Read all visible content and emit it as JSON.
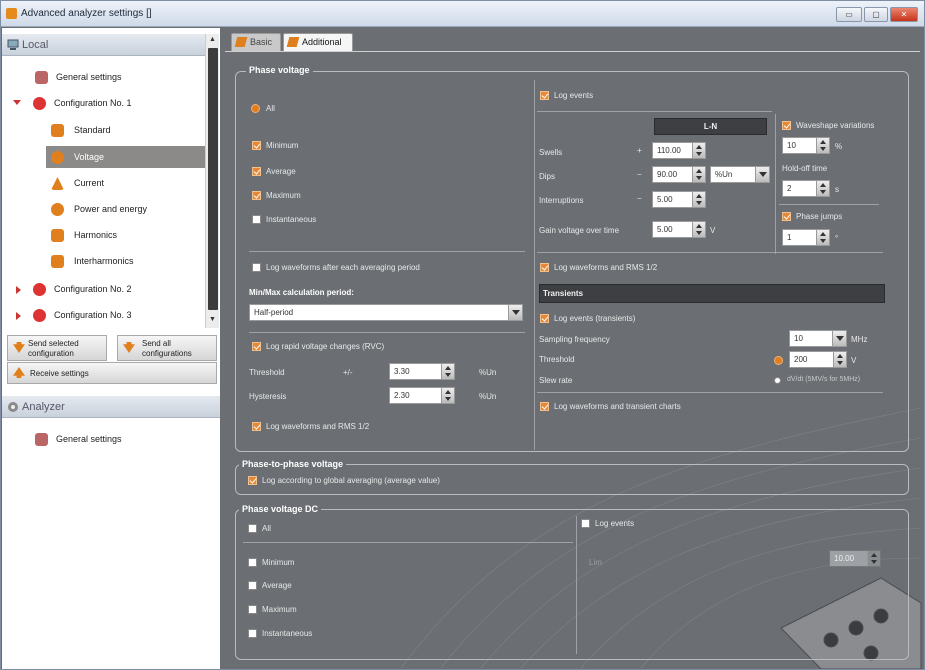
{
  "window": {
    "title": "Advanced analyzer settings []",
    "min": "▭",
    "max": "▢",
    "close": "✕"
  },
  "sidebar": {
    "local_header": "Local",
    "tree": [
      {
        "label": "General settings"
      },
      {
        "label": "Configuration No. 1"
      },
      {
        "label": "Standard"
      },
      {
        "label": "Voltage"
      },
      {
        "label": "Current"
      },
      {
        "label": "Power and energy"
      },
      {
        "label": "Harmonics"
      },
      {
        "label": "Interharmonics"
      },
      {
        "label": "Configuration No. 2"
      },
      {
        "label": "Configuration No. 3"
      }
    ],
    "send_selected_l1": "Send selected",
    "send_selected_l2": "configuration",
    "send_all_l1": "Send all",
    "send_all_l2": "configurations",
    "receive": "Receive settings",
    "analyzer_header": "Analyzer",
    "analyzer_general": "General settings"
  },
  "tabs": {
    "basic": "Basic",
    "additional": "Additional"
  },
  "phase_voltage": {
    "title": "Phase voltage",
    "all": "All",
    "minimum": "Minimum",
    "average": "Average",
    "maximum": "Maximum",
    "instantaneous": "Instantaneous",
    "log_wave_avg": "Log waveforms after each averaging period",
    "minmax_title": "Min/Max calculation period:",
    "minmax_value": "Half-period",
    "log_rvc": "Log rapid voltage changes (RVC)",
    "threshold": "Threshold",
    "pm": "+/-",
    "threshold_val": "3.30",
    "unit": "%Un",
    "hysteresis": "Hysteresis",
    "hyst_val": "2.30",
    "log_rvc_wave": "Log waveforms and RMS 1/2",
    "log_events": "Log events",
    "ln_header": "L-N",
    "swells": "Swells",
    "swells_val": "110.00",
    "dips": "Dips",
    "dips_val": "90.00",
    "dips_unit": "%Un",
    "interruptions": "Interruptions",
    "interr_val": "5.00",
    "gain_time": "Gain voltage over time",
    "gain_val": "5.00",
    "gain_unit": "V",
    "waveshape": "Waveshape variations",
    "waveshape_val": "10",
    "pct": "%",
    "holdoff": "Hold-off time",
    "holdoff_val": "2",
    "s": "s",
    "phase_jumps": "Phase jumps",
    "phase_val": "1",
    "deg": "°",
    "log_events_wave": "Log waveforms and RMS 1/2",
    "transients": "Transients",
    "log_trans": "Log events (transients)",
    "sampling": "Sampling frequency",
    "sampling_val": "10",
    "mhz": "MHz",
    "trans_threshold": "Threshold",
    "trans_thr_val": "200",
    "v": "V",
    "slew": "Slew rate",
    "slew_opt": "dV/dt (5MV/s for 5MHz)",
    "log_trans_wave": "Log waveforms and transient charts"
  },
  "ptp": {
    "title": "Phase-to-phase voltage",
    "log_global": "Log according to global averaging (average value)"
  },
  "pvdc": {
    "title": "Phase voltage DC",
    "all": "All",
    "minimum": "Minimum",
    "average": "Average",
    "maximum": "Maximum",
    "instantaneous": "Instantaneous",
    "log_events": "Log events",
    "dc_label": "Lim",
    "dc_val": "10.00"
  }
}
